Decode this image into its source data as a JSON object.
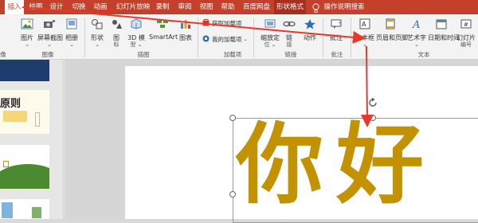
{
  "tabs": [
    "插入",
    "绘图",
    "设计",
    "切换",
    "动画",
    "幻灯片放映",
    "录制",
    "审阅",
    "视图",
    "帮助",
    "百度网盘",
    "形状格式",
    "操作说明搜索"
  ],
  "ribbon": {
    "picture": {
      "label": "图片",
      "sub": "⌄"
    },
    "screenshot": {
      "label": "屏幕截图",
      "sub": "⌄"
    },
    "album": {
      "label": "相册",
      "sub": "⌄"
    },
    "shapes": {
      "label": "形状",
      "sub": "⌄"
    },
    "icons": {
      "label": "图",
      "sub": "标"
    },
    "model3d": {
      "label": "3D 模",
      "sub": "型 ⌄"
    },
    "smartart": {
      "label": "SmartArt"
    },
    "chart": {
      "label": "图表"
    },
    "get_addins": "获取加载项",
    "my_addins": "我的加载项",
    "zoom": {
      "label": "缩放定",
      "sub": "位 ⌄"
    },
    "link": {
      "label": "链",
      "sub": "接"
    },
    "action": {
      "label": "动作"
    },
    "comment": {
      "label": "批注"
    },
    "textbox": {
      "label": "文本框",
      "sub": "⌄"
    },
    "header_footer": {
      "label": "页眉和页脚"
    },
    "wordart": {
      "label": "艺术字",
      "sub": "⌄"
    },
    "datetime": {
      "label": "日期和时间"
    },
    "slide_number": {
      "label": "幻灯片",
      "sub": "编号"
    }
  },
  "groups": {
    "images_clip": "像",
    "images": "图像",
    "illustrations": "插图",
    "addins": "加载项",
    "links": "链接",
    "comments": "批注",
    "text": "文本"
  },
  "slides_pane": {
    "thumb2_text": "原则"
  },
  "slide": {
    "text": "你好"
  },
  "colors": {
    "accent": "#c4402a",
    "slide_text": "#c39200",
    "arrow": "#e8382d"
  }
}
